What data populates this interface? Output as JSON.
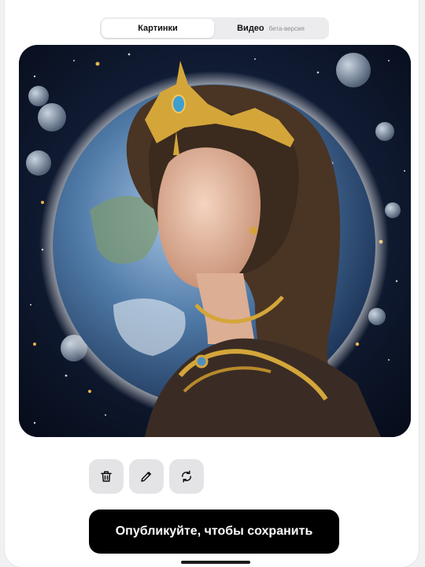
{
  "tabs": {
    "images": "Картинки",
    "video": "Видео",
    "video_badge": "бета-версия",
    "active": "images"
  },
  "image": {
    "alt": "Girl with golden crown in front of planet Earth among stars"
  },
  "toolbar": {
    "delete_icon": "trash-icon",
    "edit_icon": "pencil-icon",
    "regenerate_icon": "refresh-icon"
  },
  "publish_button": "Опубликуйте, чтобы сохранить",
  "colors": {
    "accent": "#000000",
    "gold": "#d4a63a",
    "space": "#0a1327"
  }
}
